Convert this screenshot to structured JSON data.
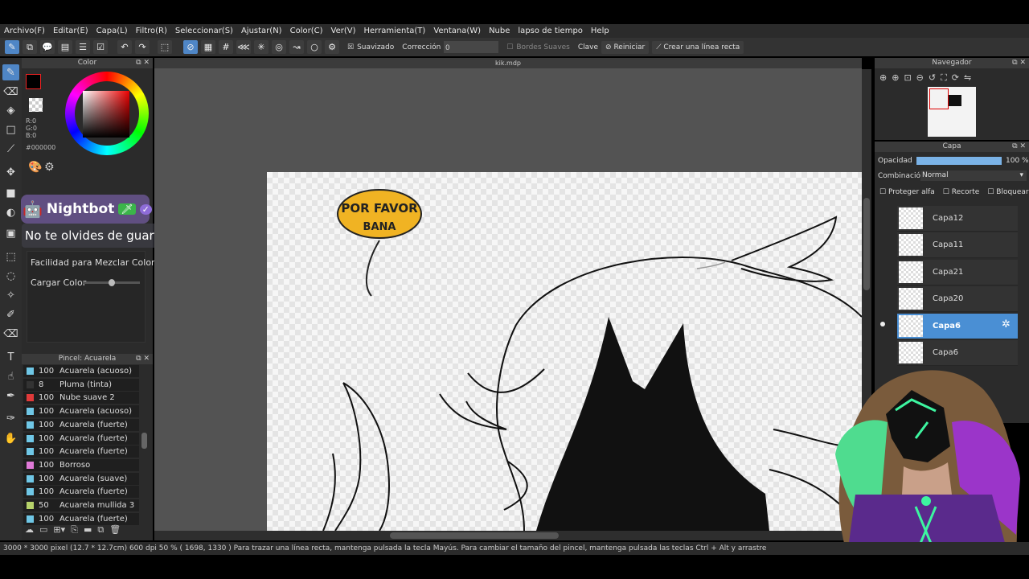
{
  "menu": [
    "Archivo(F)",
    "Editar(E)",
    "Capa(L)",
    "Filtro(R)",
    "Seleccionar(S)",
    "Ajustar(N)",
    "Color(C)",
    "Ver(V)",
    "Herramienta(T)",
    "Ventana(W)",
    "Nube",
    "lapso de tiempo",
    "Help"
  ],
  "toolbar": {
    "suavizado_label": "Suavizado",
    "correccion_label": "Corrección",
    "correccion_value": "0",
    "bordes_label": "Bordes Suaves",
    "clave_label": "Clave",
    "reiniciar_label": "Reiniciar",
    "linea_recta_label": "Crear una línea recta"
  },
  "color_panel": {
    "title": "Color",
    "r": "R:0",
    "g": "G:0",
    "b": "B:0",
    "hex": "#000000",
    "mix_label": "Facilidad para Mezclar Colores",
    "load_label": "Cargar Color",
    "load_value": 0.5
  },
  "brush_panel": {
    "title": "Pincel: Acuarela",
    "items": [
      {
        "size": "100",
        "name": "Acuarela (acuoso)",
        "color": "#6fc7e6"
      },
      {
        "size": "8",
        "name": "Pluma (tinta)",
        "color": "#333333"
      },
      {
        "size": "100",
        "name": "Nube suave 2",
        "color": "#e03a3a"
      },
      {
        "size": "100",
        "name": "Acuarela (acuoso)",
        "color": "#6fc7e6"
      },
      {
        "size": "100",
        "name": "Acuarela (fuerte)",
        "color": "#6fc7e6"
      },
      {
        "size": "100",
        "name": "Acuarela (fuerte)",
        "color": "#6fc7e6"
      },
      {
        "size": "100",
        "name": "Acuarela (fuerte)",
        "color": "#6fc7e6"
      },
      {
        "size": "100",
        "name": "Borroso",
        "color": "#e07ad8"
      },
      {
        "size": "100",
        "name": "Acuarela (suave)",
        "color": "#6fc7e6"
      },
      {
        "size": "100",
        "name": "Acuarela (fuerte)",
        "color": "#6fc7e6"
      },
      {
        "size": "50",
        "name": "Acuarela mullida 3",
        "color": "#b6d26a"
      },
      {
        "size": "100",
        "name": "Acuarela (fuerte)",
        "color": "#6fc7e6"
      }
    ]
  },
  "document": {
    "tab": "kik.mdp",
    "speech_line1": "POR FAVOR",
    "speech_line2": "BANA"
  },
  "navigator": {
    "title": "Navegador"
  },
  "layer_panel": {
    "title": "Capa",
    "opacity_label": "Opacidad",
    "opacity_value": "100 %",
    "blend_label": "Combinación",
    "blend_value": "Normal",
    "protect_label": "Proteger alfa",
    "clip_label": "Recorte",
    "lock_label": "Bloquear",
    "layers": [
      "Capa12",
      "Capa11",
      "Capa21",
      "Capa20",
      "Capa6",
      "Capa6"
    ]
  },
  "status": "3000 * 3000 pixel    (12.7 * 12.7cm)   600 dpi    50 %    ( 1698, 1330 )   Para trazar una línea recta, mantenga pulsada la tecla Mayús. Para cambiar el tamaño del pincel, mantenga pulsada las teclas Ctrl + Alt y arrastre",
  "overlay": {
    "bot_name": "Nightbot",
    "message": "No te olvides de guardar"
  }
}
